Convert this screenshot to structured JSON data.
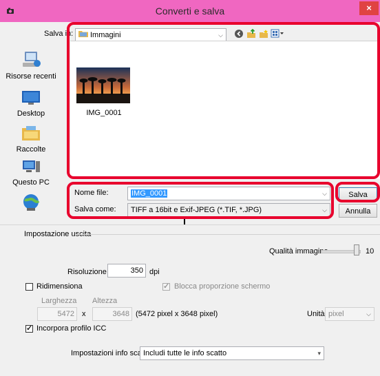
{
  "window": {
    "title": "Converti e salva",
    "close": "×"
  },
  "savein": {
    "label": "Salva in:",
    "value": "Immagini"
  },
  "places": [
    {
      "label": "Risorse recenti",
      "icon": "recent-places-icon"
    },
    {
      "label": "Desktop",
      "icon": "desktop-icon"
    },
    {
      "label": "Raccolte",
      "icon": "libraries-icon"
    },
    {
      "label": "Questo PC",
      "icon": "this-pc-icon"
    },
    {
      "label": "",
      "icon": "network-icon"
    }
  ],
  "files": [
    {
      "name": "IMG_0001"
    }
  ],
  "filename": {
    "label": "Nome file:",
    "value": "IMG_0001"
  },
  "savetype": {
    "label": "Salva come:",
    "value": "TIFF a 16bit e Exif-JPEG (*.TIF, *.JPG)"
  },
  "buttons": {
    "save": "Salva",
    "cancel": "Annulla"
  },
  "output": {
    "section": "Impostazione uscita",
    "quality_label": "Qualità immagine",
    "quality_value": "10",
    "quality_fraction": 1.0,
    "resolution_label": "Risoluzione",
    "resolution_value": "350",
    "resolution_unit": "dpi",
    "resize_label": "Ridimensiona",
    "resize_checked": false,
    "keep_ratio_label": "Blocca proporzione schermo",
    "keep_ratio_checked": true,
    "width_label": "Larghezza",
    "height_label": "Altezza",
    "width_value": "5472",
    "times": "x",
    "height_value": "3648",
    "pixel_info": "(5472 pixel x 3648 pixel)",
    "unit_label": "Unità",
    "unit_value": "pixel",
    "icc_label": "Incorpora profilo ICC",
    "icc_checked": true,
    "shot_info_label": "Impostazioni info scatto",
    "shot_info_value": "Includi tutte le info scatto"
  },
  "colors": {
    "titlebar": "#f067c1",
    "close": "#e04343",
    "highlight": "#e8002d",
    "selection": "#3399ff"
  }
}
